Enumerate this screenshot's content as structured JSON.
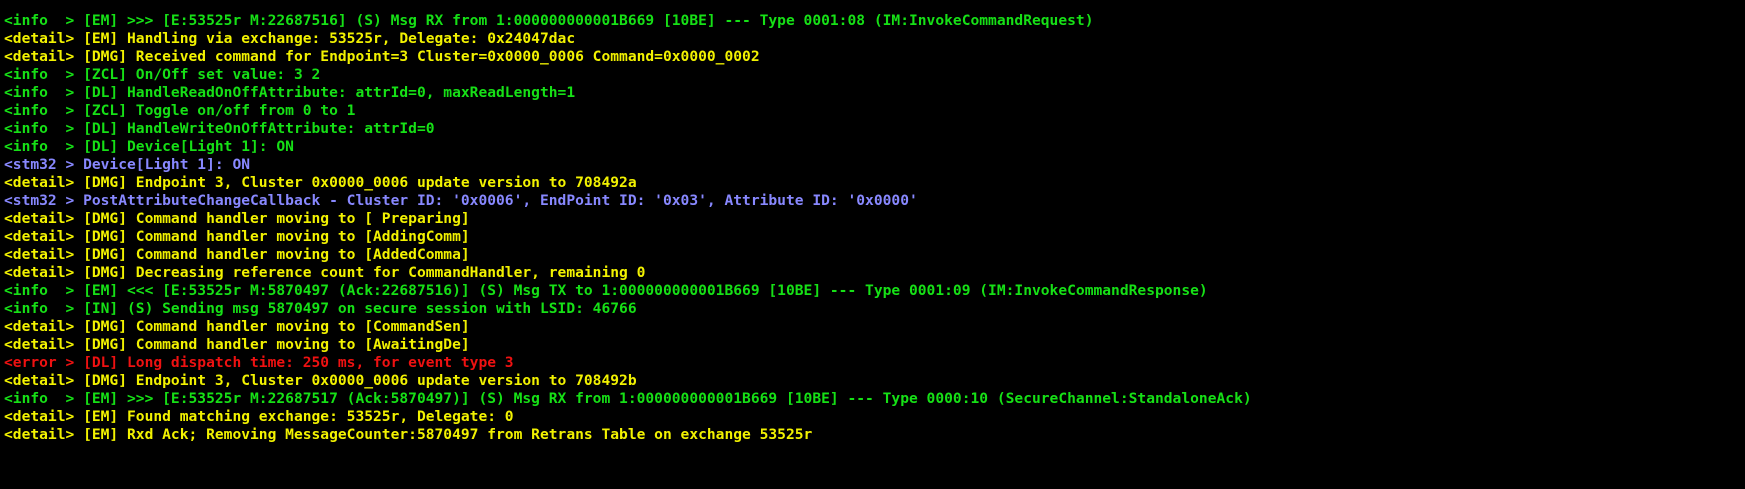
{
  "colors": {
    "background": "#000000",
    "info": "#16e016",
    "detail": "#f2f200",
    "stm32": "#8888ff",
    "error": "#ee1111"
  },
  "console": {
    "lines": [
      {
        "level": "info",
        "text": "<info  > [EM] >>> [E:53525r M:22687516] (S) Msg RX from 1:000000000001B669 [10BE] --- Type 0001:08 (IM:InvokeCommandRequest)"
      },
      {
        "level": "detail",
        "text": "<detail> [EM] Handling via exchange: 53525r, Delegate: 0x24047dac"
      },
      {
        "level": "detail",
        "text": "<detail> [DMG] Received command for Endpoint=3 Cluster=0x0000_0006 Command=0x0000_0002"
      },
      {
        "level": "info",
        "text": "<info  > [ZCL] On/Off set value: 3 2"
      },
      {
        "level": "info",
        "text": "<info  > [DL] HandleReadOnOffAttribute: attrId=0, maxReadLength=1"
      },
      {
        "level": "info",
        "text": "<info  > [ZCL] Toggle on/off from 0 to 1"
      },
      {
        "level": "info",
        "text": "<info  > [DL] HandleWriteOnOffAttribute: attrId=0"
      },
      {
        "level": "info",
        "text": "<info  > [DL] Device[Light 1]: ON"
      },
      {
        "level": "stm32",
        "text": "<stm32 > Device[Light 1]: ON"
      },
      {
        "level": "detail",
        "text": "<detail> [DMG] Endpoint 3, Cluster 0x0000_0006 update version to 708492a"
      },
      {
        "level": "stm32",
        "text": "<stm32 > PostAttributeChangeCallback - Cluster ID: '0x0006', EndPoint ID: '0x03', Attribute ID: '0x0000'"
      },
      {
        "level": "detail",
        "text": "<detail> [DMG] Command handler moving to [ Preparing]"
      },
      {
        "level": "detail",
        "text": "<detail> [DMG] Command handler moving to [AddingComm]"
      },
      {
        "level": "detail",
        "text": "<detail> [DMG] Command handler moving to [AddedComma]"
      },
      {
        "level": "detail",
        "text": "<detail> [DMG] Decreasing reference count for CommandHandler, remaining 0"
      },
      {
        "level": "info",
        "text": "<info  > [EM] <<< [E:53525r M:5870497 (Ack:22687516)] (S) Msg TX to 1:000000000001B669 [10BE] --- Type 0001:09 (IM:InvokeCommandResponse)"
      },
      {
        "level": "info",
        "text": "<info  > [IN] (S) Sending msg 5870497 on secure session with LSID: 46766"
      },
      {
        "level": "detail",
        "text": "<detail> [DMG] Command handler moving to [CommandSen]"
      },
      {
        "level": "detail",
        "text": "<detail> [DMG] Command handler moving to [AwaitingDe]"
      },
      {
        "level": "error",
        "text": "<error > [DL] Long dispatch time: 250 ms, for event type 3"
      },
      {
        "level": "detail",
        "text": "<detail> [DMG] Endpoint 3, Cluster 0x0000_0006 update version to 708492b"
      },
      {
        "level": "info",
        "text": "<info  > [EM] >>> [E:53525r M:22687517 (Ack:5870497)] (S) Msg RX from 1:000000000001B669 [10BE] --- Type 0000:10 (SecureChannel:StandaloneAck)"
      },
      {
        "level": "detail",
        "text": "<detail> [EM] Found matching exchange: 53525r, Delegate: 0"
      },
      {
        "level": "detail",
        "text": "<detail> [EM] Rxd Ack; Removing MessageCounter:5870497 from Retrans Table on exchange 53525r"
      }
    ]
  }
}
